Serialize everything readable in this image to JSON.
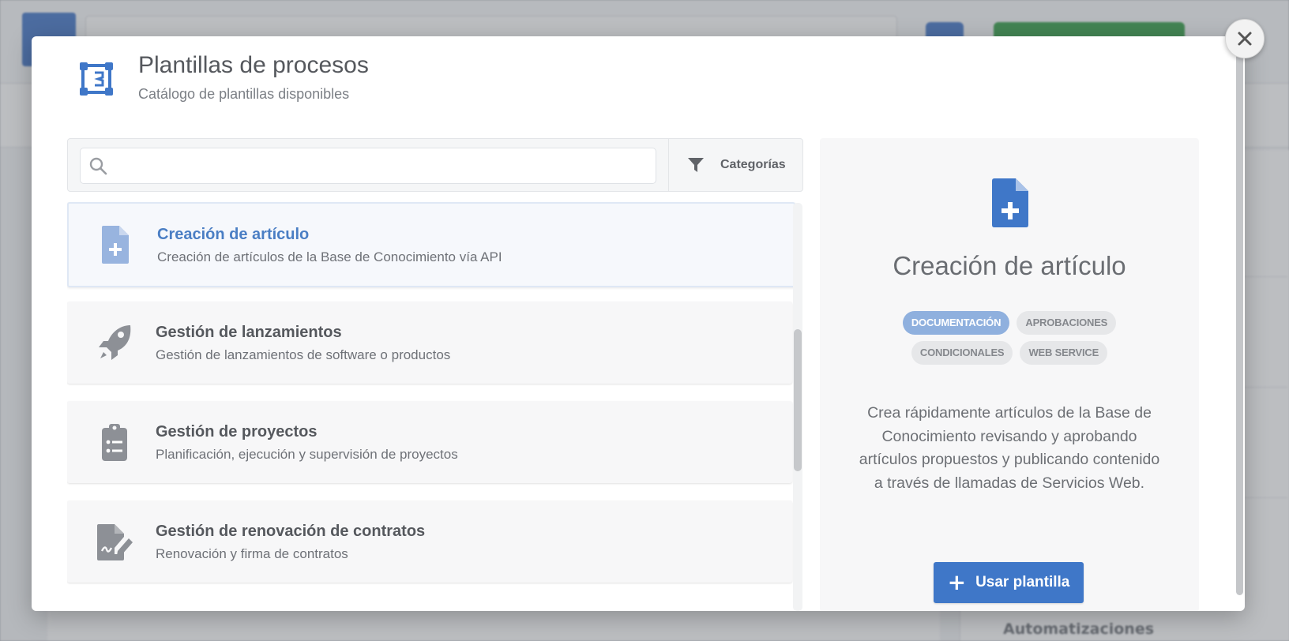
{
  "modal": {
    "title": "Plantillas de procesos",
    "subtitle": "Catálogo de plantillas disponibles",
    "icon": "process-template-icon"
  },
  "search": {
    "value": "",
    "placeholder": "",
    "icon": "search-icon"
  },
  "categories_label": "Categorías",
  "templates": [
    {
      "title": "Creación de artículo",
      "description": "Creación de artículos de la Base de Conocimiento vía API",
      "icon": "file-plus-icon",
      "selected": true
    },
    {
      "title": "Gestión de lanzamientos",
      "description": "Gestión de lanzamientos de software o productos",
      "icon": "rocket-icon",
      "selected": false
    },
    {
      "title": "Gestión de proyectos",
      "description": "Planificación, ejecución y supervisión de proyectos",
      "icon": "clipboard-list-icon",
      "selected": false
    },
    {
      "title": "Gestión de renovación de contratos",
      "description": "Renovación y firma de contratos",
      "icon": "file-signature-icon",
      "selected": false
    }
  ],
  "detail": {
    "title": "Creación de artículo",
    "tags": [
      {
        "label": "DOCUMENTACIÓN",
        "active": true
      },
      {
        "label": "APROBACIONES",
        "active": false
      },
      {
        "label": "CONDICIONALES",
        "active": false
      },
      {
        "label": "WEB SERVICE",
        "active": false
      }
    ],
    "description": "Crea rápidamente artículos de la Base de Conocimiento revisando y aprobando artículos propuestos y publicando contenido a través de llamadas de Servicios Web.",
    "button_icon": "+",
    "button_label": "Usar plantilla"
  },
  "background": {
    "automations_label": "Automatizaciones"
  },
  "colors": {
    "accent": "#3f77c8",
    "tag_active": "#8fb0de",
    "selected_title": "#4a7ec4"
  }
}
